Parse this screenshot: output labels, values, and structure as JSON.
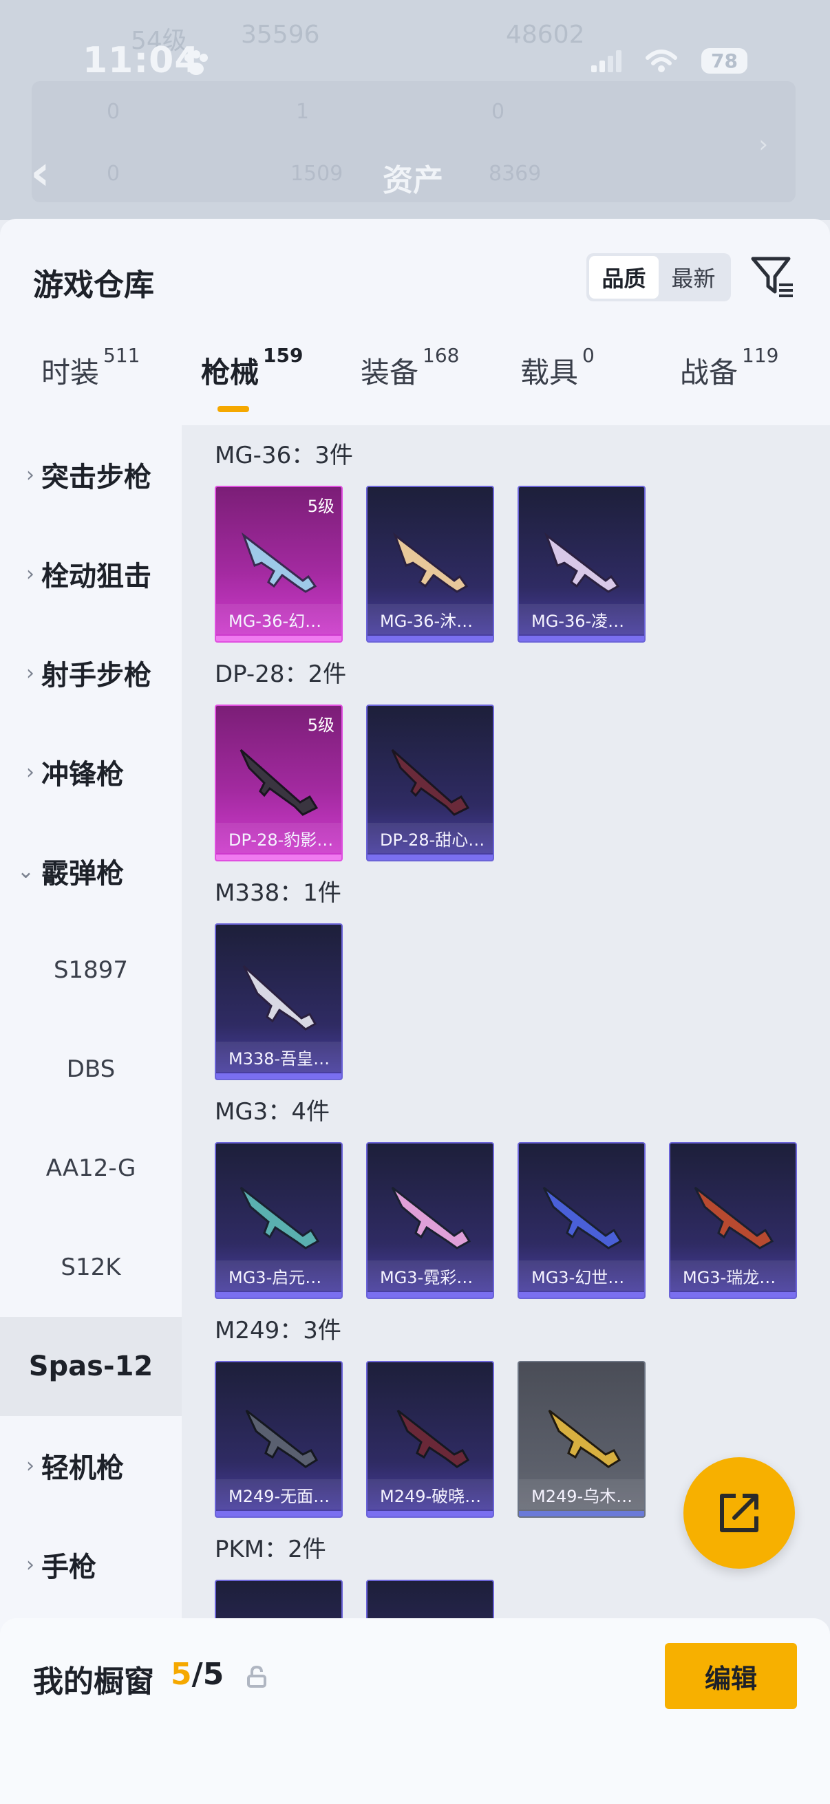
{
  "background": {
    "status_time": "11:04",
    "battery": "78",
    "title": "资产",
    "faded_texts": [
      "54级",
      "35596",
      "48602",
      "0",
      "1",
      "0",
      "0",
      "1509",
      "8369"
    ]
  },
  "sheet": {
    "title": "游戏仓库",
    "sort_options": [
      "品质",
      "最新"
    ],
    "active_sort": "品质"
  },
  "tabs": [
    {
      "label": "时装",
      "count": "511"
    },
    {
      "label": "枪械",
      "count": "159"
    },
    {
      "label": "装备",
      "count": "168"
    },
    {
      "label": "载具",
      "count": "0"
    },
    {
      "label": "战备",
      "count": "119"
    }
  ],
  "sidebar": {
    "categories": [
      "突击步枪",
      "栓动狙击",
      "射手步枪",
      "冲锋枪",
      "霰弹枪"
    ],
    "sub_items": [
      "S1897",
      "DBS",
      "AA12-G",
      "S12K",
      "Spas-12"
    ],
    "selected_sub": "Spas-12",
    "more_categories": [
      "轻机枪",
      "手枪"
    ]
  },
  "groups": [
    {
      "label": "MG-36：3件",
      "items": [
        {
          "name": "MG-36-幻…",
          "level": "5级",
          "rarity": "pink"
        },
        {
          "name": "MG-36-沐…",
          "rarity": "purple"
        },
        {
          "name": "MG-36-凌…",
          "rarity": "purple"
        }
      ]
    },
    {
      "label": "DP-28：2件",
      "items": [
        {
          "name": "DP-28-豹影…",
          "level": "5级",
          "rarity": "pink"
        },
        {
          "name": "DP-28-甜心…",
          "rarity": "purple"
        }
      ]
    },
    {
      "label": "M338：1件",
      "items": [
        {
          "name": "M338-吾皇…",
          "rarity": "purple"
        }
      ]
    },
    {
      "label": "MG3：4件",
      "items": [
        {
          "name": "MG3-启元…",
          "rarity": "purple"
        },
        {
          "name": "MG3-霓彩…",
          "rarity": "purple"
        },
        {
          "name": "MG3-幻世…",
          "rarity": "purple"
        },
        {
          "name": "MG3-瑞龙…",
          "rarity": "purple"
        }
      ]
    },
    {
      "label": "M249：3件",
      "items": [
        {
          "name": "M249-无面…",
          "rarity": "purple"
        },
        {
          "name": "M249-破晓…",
          "rarity": "purple"
        },
        {
          "name": "M249-乌木…",
          "rarity": "grey"
        }
      ]
    },
    {
      "label": "PKM：2件",
      "items": [
        {
          "name": "",
          "rarity": "purple"
        },
        {
          "name": "",
          "rarity": "purple"
        }
      ]
    }
  ],
  "showcase": {
    "label": "我的橱窗",
    "current": "5",
    "total": "/5",
    "edit_label": "编辑"
  },
  "colors": {
    "accent": "#f7b000",
    "pink_rarity": "#d13dd0",
    "purple_rarity": "#4b40a6"
  },
  "icons": [
    "back-chevron-icon",
    "filter-icon",
    "chevron-right-icon",
    "chevron-down-icon",
    "share-out-icon",
    "lock-icon",
    "paw-icon",
    "signal-icon",
    "wifi-icon"
  ]
}
